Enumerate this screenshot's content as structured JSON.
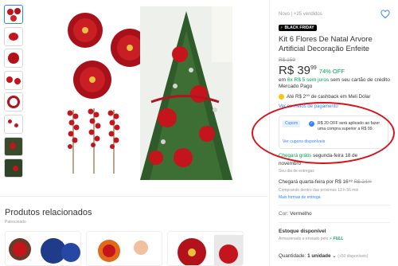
{
  "product": {
    "condition": "Novo  |  +25 vendidos",
    "badge": "BLACK FRIDAY",
    "title": "Kit 6 Flores De Natal Arvore Artificial Decoração Enfeite",
    "old_price": "R$ 159",
    "price_main": "R$ 39",
    "price_cents": "99",
    "discount": "74% OFF",
    "installments_prefix": "em",
    "installments_green": "6x R$ 5 sem juros",
    "installments_suffix": "sem seu cartão de crédito Mercado Pago",
    "cashback": "Até R$ 2⁰⁰ de cashback em Meli Dólar",
    "payment_link": "Ver os meios de pagamento"
  },
  "coupon": {
    "tag": "Cupom",
    "text": "R$ 20 OFF será aplicado ao fazer uma compra superior a R$ 99.",
    "link": "Ver cupons disponíveis"
  },
  "shipping": {
    "line1_green": "Chegará grátis",
    "line1_rest": "segunda-feira 18 de",
    "line1b": "novembro",
    "line1_sub": "Seu dia de entregas",
    "line2_prefix": "Chegará quarta-feira por",
    "line2_price": "R$ 16⁹⁸",
    "line2_old": "R$ 24⁹⁸",
    "line2_sub": "Comprando dentro das próximas 13 h 56 min",
    "line2_link": "Mais formas de entrega"
  },
  "options": {
    "color_label": "Cor:",
    "color_value": "Vermelho",
    "stock": "Estoque disponível",
    "stock_sub": "Armazenado e enviado pelo",
    "full": "⚡ FULL",
    "qty_label": "Quantidade:",
    "qty_value": "1 unidade",
    "qty_avail": "(+50 disponíveis)"
  },
  "related": {
    "title": "Produtos relacionados",
    "subtitle": "Patrocinado"
  },
  "colors": {
    "accent": "#3483fa",
    "green": "#00a650",
    "highlight": "#d6121b",
    "flower_red": "#c4141c"
  }
}
